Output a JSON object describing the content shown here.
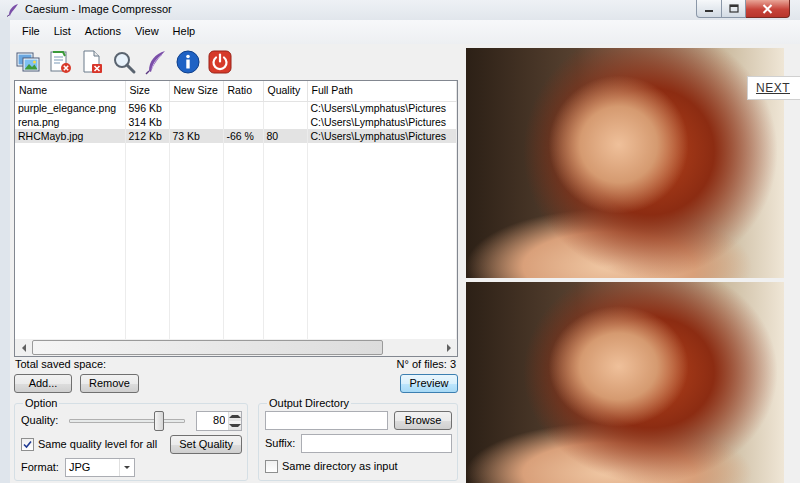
{
  "window": {
    "title": "Caesium - Image Compressor"
  },
  "menu": [
    "File",
    "List",
    "Actions",
    "View",
    "Help"
  ],
  "table": {
    "columns": [
      "Name",
      "Size",
      "New Size",
      "Ratio",
      "Quality",
      "Full Path"
    ],
    "rows": [
      {
        "cells": [
          "purple_elegance.png",
          "596 Kb",
          "",
          "",
          "",
          "C:\\Users\\Lymphatus\\Pictures"
        ],
        "selected": false
      },
      {
        "cells": [
          "rena.png",
          "314 Kb",
          "",
          "",
          "",
          "C:\\Users\\Lymphatus\\Pictures"
        ],
        "selected": false
      },
      {
        "cells": [
          "RHCMayb.jpg",
          "212 Kb",
          "73 Kb",
          "-66 %",
          "80",
          "C:\\Users\\Lymphatus\\Pictures"
        ],
        "selected": true
      }
    ]
  },
  "scrollbar": {
    "level": 0.86
  },
  "summary": {
    "saved": "Total saved space:",
    "files": "N° of files: 3"
  },
  "list_buttons": [
    {
      "label": "Add...",
      "focused": false
    },
    {
      "label": "Remove",
      "focused": false
    },
    {
      "label": "Preview",
      "focused": true
    }
  ],
  "options": {
    "title": "Option",
    "quality_label": "Quality:",
    "quality_level": 0.78,
    "quality_value": "80",
    "same_quality": {
      "label": "Same quality level for all",
      "checked": true
    },
    "set_quality": "Set Quality",
    "format_label": "Format:",
    "format_value": "JPG"
  },
  "output": {
    "title": "Output Directory",
    "browse": "Browse",
    "suffix_label": "Suffix:",
    "same_dir": {
      "label": "Same directory as input",
      "checked": false
    }
  },
  "overlay": {
    "label": "NEXT"
  }
}
